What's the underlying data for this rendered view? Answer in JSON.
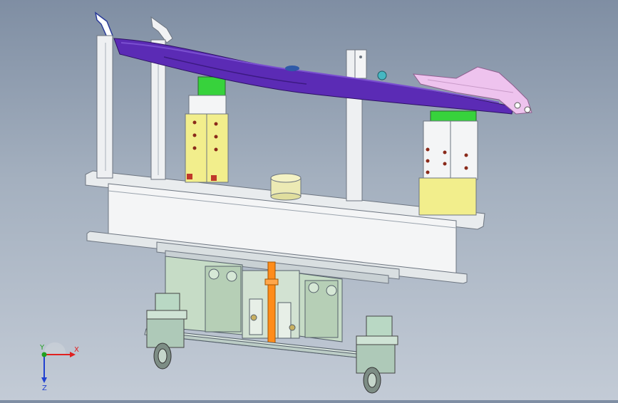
{
  "viewport": {
    "model": "fixture-trolley-assembly",
    "background_top": "#7f8ea3",
    "background_bottom": "#c3cbd6"
  },
  "colors": {
    "part_purple": "#5b2bb5",
    "block_green": "#37d23c",
    "block_yellow": "#f2ee8c",
    "frame_white": "#f1f2f4",
    "base_grey": "#dfe4e6",
    "mechanism_green": "#c6dcc6",
    "screw_orange": "#ff8c1a",
    "caster_green": "#b9d8c4"
  },
  "triad": {
    "x_label": "X",
    "y_label": "Y",
    "z_label": "Z",
    "x_color": "#e02020",
    "y_color": "#20a020",
    "z_color": "#2040d0"
  }
}
